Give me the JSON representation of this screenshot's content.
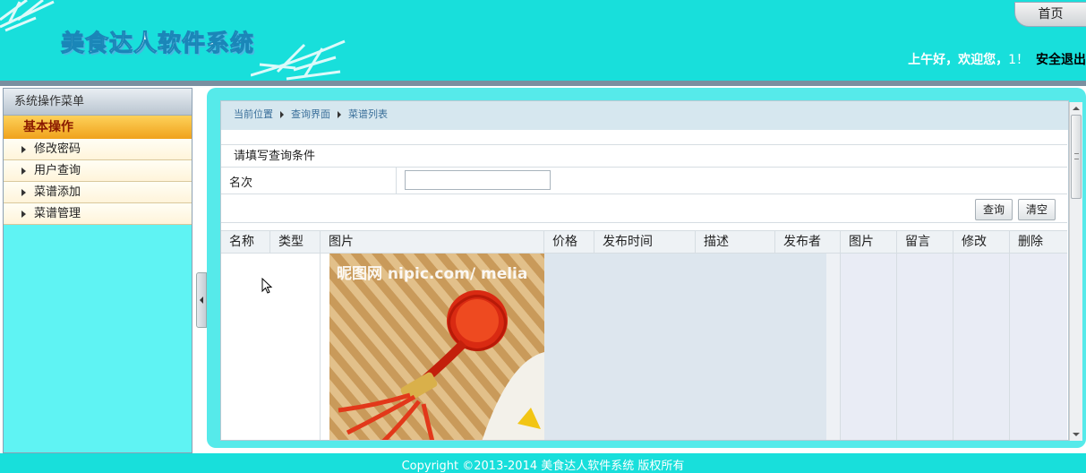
{
  "header": {
    "app_title": "美食达人软件系统",
    "home_label": "首页",
    "greeting": "上午好，欢迎您，",
    "username": "1！",
    "logout_label": "安全退出"
  },
  "sidebar": {
    "title": "系统操作菜单",
    "group_label": "基本操作",
    "items": [
      {
        "label": "修改密码"
      },
      {
        "label": "用户查询"
      },
      {
        "label": "菜谱添加"
      },
      {
        "label": "菜谱管理"
      }
    ]
  },
  "breadcrumb": {
    "items": [
      "当前位置",
      "查询界面",
      "菜谱列表"
    ]
  },
  "query": {
    "title": "请填写查询条件",
    "field_label": "名次",
    "field_value": "",
    "search_label": "查询",
    "clear_label": "清空"
  },
  "table": {
    "columns": [
      "名称",
      "类型",
      "图片",
      "价格",
      "发布时间",
      "描述",
      "发布者",
      "图片",
      "留言",
      "修改",
      "删除"
    ]
  },
  "image": {
    "watermark": "昵图网 nipic.com/ melia"
  },
  "footer": {
    "text": "Copyright ©2013-2014 美食达人软件系统 版权所有"
  },
  "colors": {
    "header_bg": "#18dfdb",
    "sidebar_bg": "#5ff3f3",
    "group_bg": "#f0a21c",
    "main_frame": "#56eaea"
  }
}
